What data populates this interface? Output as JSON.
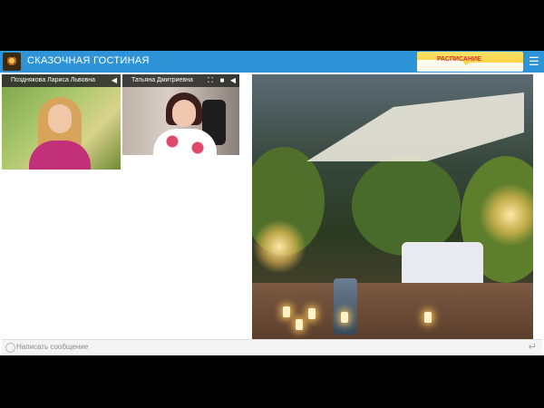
{
  "header": {
    "logo_icon": "app-logo-icon",
    "title": "СКАЗОЧНАЯ ГОСТИНАЯ",
    "schedule_label": "РАСПИСАНИЕ",
    "menu_icon": "hamburger-menu-icon"
  },
  "participants": [
    {
      "name": "Позднякова Лариса Львовна",
      "icons": [
        "speaker-icon"
      ]
    },
    {
      "name": "Татьяна Дмитриевна",
      "icons": [
        "fullscreen-icon",
        "camera-icon",
        "speaker-icon"
      ]
    }
  ],
  "presentation": {
    "image": "garden-pergola-photo"
  },
  "chat": {
    "placeholder": "Написать сообщение",
    "emoji_icon": "emoji-icon",
    "send_icon": "enter-icon"
  },
  "colors": {
    "accent": "#2f93d8",
    "schedule_bg": "#f8c62a",
    "schedule_text": "#d0312d"
  }
}
